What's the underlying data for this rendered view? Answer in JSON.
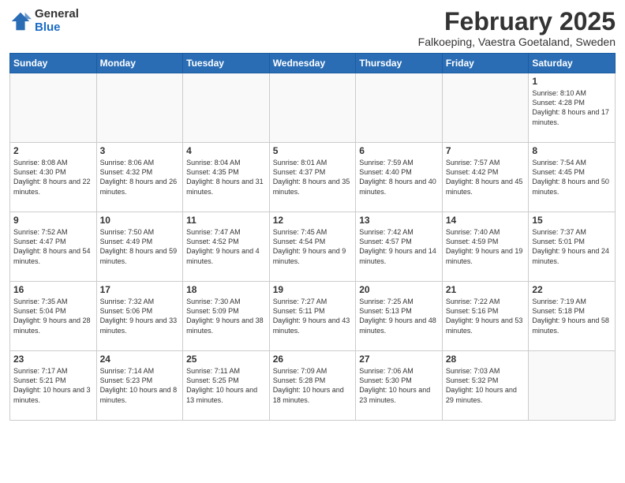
{
  "logo": {
    "general": "General",
    "blue": "Blue"
  },
  "title": "February 2025",
  "location": "Falkoeping, Vaestra Goetaland, Sweden",
  "weekdays": [
    "Sunday",
    "Monday",
    "Tuesday",
    "Wednesday",
    "Thursday",
    "Friday",
    "Saturday"
  ],
  "weeks": [
    [
      {
        "day": "",
        "info": ""
      },
      {
        "day": "",
        "info": ""
      },
      {
        "day": "",
        "info": ""
      },
      {
        "day": "",
        "info": ""
      },
      {
        "day": "",
        "info": ""
      },
      {
        "day": "",
        "info": ""
      },
      {
        "day": "1",
        "info": "Sunrise: 8:10 AM\nSunset: 4:28 PM\nDaylight: 8 hours and 17 minutes."
      }
    ],
    [
      {
        "day": "2",
        "info": "Sunrise: 8:08 AM\nSunset: 4:30 PM\nDaylight: 8 hours and 22 minutes."
      },
      {
        "day": "3",
        "info": "Sunrise: 8:06 AM\nSunset: 4:32 PM\nDaylight: 8 hours and 26 minutes."
      },
      {
        "day": "4",
        "info": "Sunrise: 8:04 AM\nSunset: 4:35 PM\nDaylight: 8 hours and 31 minutes."
      },
      {
        "day": "5",
        "info": "Sunrise: 8:01 AM\nSunset: 4:37 PM\nDaylight: 8 hours and 35 minutes."
      },
      {
        "day": "6",
        "info": "Sunrise: 7:59 AM\nSunset: 4:40 PM\nDaylight: 8 hours and 40 minutes."
      },
      {
        "day": "7",
        "info": "Sunrise: 7:57 AM\nSunset: 4:42 PM\nDaylight: 8 hours and 45 minutes."
      },
      {
        "day": "8",
        "info": "Sunrise: 7:54 AM\nSunset: 4:45 PM\nDaylight: 8 hours and 50 minutes."
      }
    ],
    [
      {
        "day": "9",
        "info": "Sunrise: 7:52 AM\nSunset: 4:47 PM\nDaylight: 8 hours and 54 minutes."
      },
      {
        "day": "10",
        "info": "Sunrise: 7:50 AM\nSunset: 4:49 PM\nDaylight: 8 hours and 59 minutes."
      },
      {
        "day": "11",
        "info": "Sunrise: 7:47 AM\nSunset: 4:52 PM\nDaylight: 9 hours and 4 minutes."
      },
      {
        "day": "12",
        "info": "Sunrise: 7:45 AM\nSunset: 4:54 PM\nDaylight: 9 hours and 9 minutes."
      },
      {
        "day": "13",
        "info": "Sunrise: 7:42 AM\nSunset: 4:57 PM\nDaylight: 9 hours and 14 minutes."
      },
      {
        "day": "14",
        "info": "Sunrise: 7:40 AM\nSunset: 4:59 PM\nDaylight: 9 hours and 19 minutes."
      },
      {
        "day": "15",
        "info": "Sunrise: 7:37 AM\nSunset: 5:01 PM\nDaylight: 9 hours and 24 minutes."
      }
    ],
    [
      {
        "day": "16",
        "info": "Sunrise: 7:35 AM\nSunset: 5:04 PM\nDaylight: 9 hours and 28 minutes."
      },
      {
        "day": "17",
        "info": "Sunrise: 7:32 AM\nSunset: 5:06 PM\nDaylight: 9 hours and 33 minutes."
      },
      {
        "day": "18",
        "info": "Sunrise: 7:30 AM\nSunset: 5:09 PM\nDaylight: 9 hours and 38 minutes."
      },
      {
        "day": "19",
        "info": "Sunrise: 7:27 AM\nSunset: 5:11 PM\nDaylight: 9 hours and 43 minutes."
      },
      {
        "day": "20",
        "info": "Sunrise: 7:25 AM\nSunset: 5:13 PM\nDaylight: 9 hours and 48 minutes."
      },
      {
        "day": "21",
        "info": "Sunrise: 7:22 AM\nSunset: 5:16 PM\nDaylight: 9 hours and 53 minutes."
      },
      {
        "day": "22",
        "info": "Sunrise: 7:19 AM\nSunset: 5:18 PM\nDaylight: 9 hours and 58 minutes."
      }
    ],
    [
      {
        "day": "23",
        "info": "Sunrise: 7:17 AM\nSunset: 5:21 PM\nDaylight: 10 hours and 3 minutes."
      },
      {
        "day": "24",
        "info": "Sunrise: 7:14 AM\nSunset: 5:23 PM\nDaylight: 10 hours and 8 minutes."
      },
      {
        "day": "25",
        "info": "Sunrise: 7:11 AM\nSunset: 5:25 PM\nDaylight: 10 hours and 13 minutes."
      },
      {
        "day": "26",
        "info": "Sunrise: 7:09 AM\nSunset: 5:28 PM\nDaylight: 10 hours and 18 minutes."
      },
      {
        "day": "27",
        "info": "Sunrise: 7:06 AM\nSunset: 5:30 PM\nDaylight: 10 hours and 23 minutes."
      },
      {
        "day": "28",
        "info": "Sunrise: 7:03 AM\nSunset: 5:32 PM\nDaylight: 10 hours and 29 minutes."
      },
      {
        "day": "",
        "info": ""
      }
    ]
  ]
}
